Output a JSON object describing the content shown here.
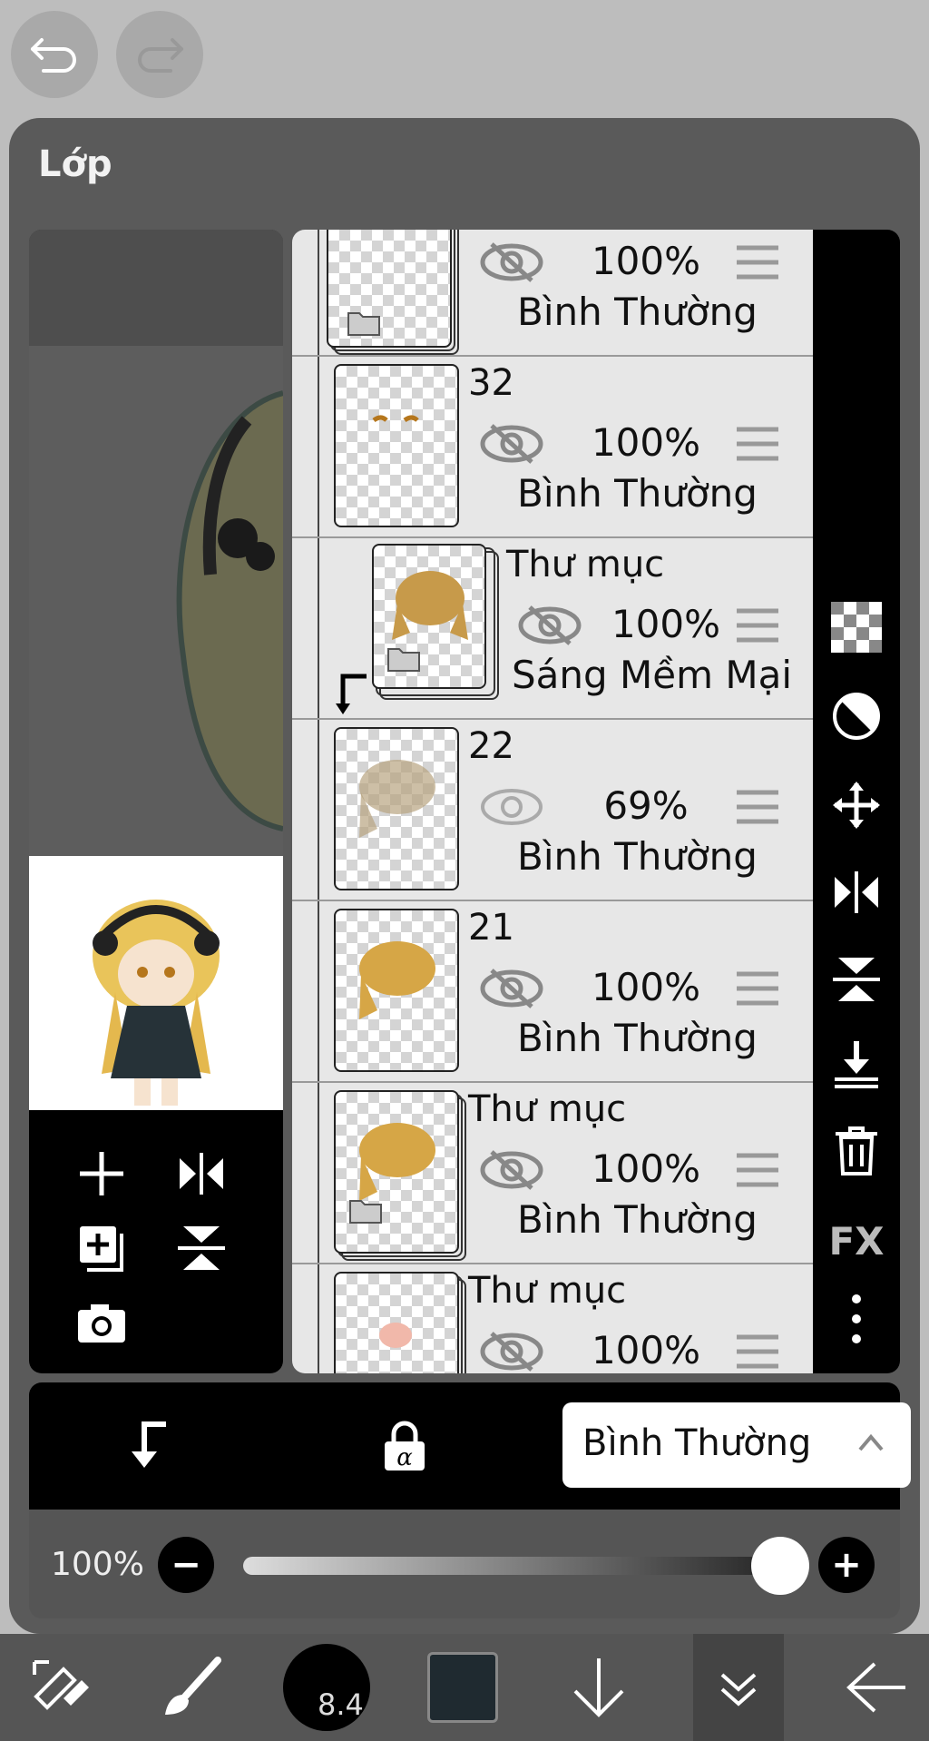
{
  "panel": {
    "title": "Lớp"
  },
  "layers": [
    {
      "name": "",
      "opacity": "100%",
      "blend": "Bình Thường",
      "is_folder": true,
      "visible": true
    },
    {
      "name": "32",
      "opacity": "100%",
      "blend": "Bình Thường",
      "is_folder": false,
      "visible": true
    },
    {
      "name": "Thư mục",
      "opacity": "100%",
      "blend": "Sáng Mềm Mại",
      "is_folder": true,
      "visible": true,
      "clipped": true
    },
    {
      "name": "22",
      "opacity": "69%",
      "blend": "Bình Thường",
      "is_folder": false,
      "visible": false
    },
    {
      "name": "21",
      "opacity": "100%",
      "blend": "Bình Thường",
      "is_folder": false,
      "visible": true
    },
    {
      "name": "Thư mục",
      "opacity": "100%",
      "blend": "Bình Thường",
      "is_folder": true,
      "visible": true
    },
    {
      "name": "Thư mục",
      "opacity": "100%",
      "blend": "",
      "is_folder": true,
      "visible": true
    }
  ],
  "right_toolbar": {
    "fx_label": "FX"
  },
  "bottom": {
    "blend_mode": "Bình Thường"
  },
  "opacity": {
    "label": "100%",
    "value": 1.0
  },
  "toolbar": {
    "brush_size": "8.4"
  },
  "colors": {
    "panel": "#5a5a5a",
    "layer_bg": "#e7e7e7",
    "accent": "#000000",
    "current_color": "#1f2a30"
  }
}
